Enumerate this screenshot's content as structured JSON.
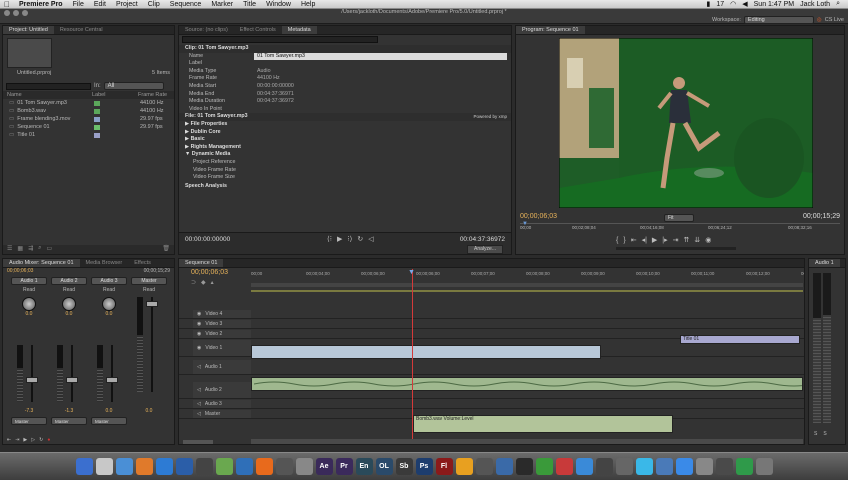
{
  "menubar": {
    "app_name": "Premiere Pro",
    "items": [
      "File",
      "Edit",
      "Project",
      "Clip",
      "Sequence",
      "Marker",
      "Title",
      "Window",
      "Help"
    ],
    "date_time": "Sun 1:47 PM",
    "user": "Jack Loth",
    "battery_level": "17"
  },
  "titlebar": {
    "path": "/Users/jackloth/Documents/Adobe/Premiere Pro/5.0/Untitled.prproj *",
    "workspace_label": "Workspace:",
    "workspace_value": "Editing",
    "cs_live": "CS Live"
  },
  "project_panel": {
    "tabs": [
      "Project: Untitled",
      "Resource Central"
    ],
    "project_file": "Untitled.prproj",
    "items_count": "5 Items",
    "in_label": "In:",
    "in_value": "All",
    "columns": [
      "Name",
      "Label",
      "Frame Rate"
    ],
    "rows": [
      {
        "name": "01 Tom Sawyer.mp3",
        "rate": "44100 Hz",
        "color": "#5ba85b"
      },
      {
        "name": "Bomb3.wav",
        "rate": "44100 Hz",
        "color": "#5ba85b"
      },
      {
        "name": "Frame blending3.mov",
        "rate": "29.97 fps",
        "color": "#8aa0c8"
      },
      {
        "name": "Sequence 01",
        "rate": "29.97 fps",
        "color": "#6bbf6b"
      },
      {
        "name": "Title 01",
        "rate": "",
        "color": "#9aa0c8"
      }
    ]
  },
  "metadata_panel": {
    "tabs": [
      "Source: (no clips)",
      "Effect Controls",
      "Metadata"
    ],
    "clip_header": "Clip: 01 Tom Sawyer.mp3",
    "fields": [
      {
        "k": "Name",
        "v": "01 Tom Sawyer.mp3",
        "input": true
      },
      {
        "k": "Label",
        "v": "",
        "input": false
      },
      {
        "k": "Media Type",
        "v": "Audio",
        "input": false
      },
      {
        "k": "Frame Rate",
        "v": "44100 Hz",
        "input": false
      },
      {
        "k": "Media Start",
        "v": "00:00:00:00000",
        "input": false
      },
      {
        "k": "Media End",
        "v": "00:04:37:36971",
        "input": false
      },
      {
        "k": "Media Duration",
        "v": "00:04:37:36972",
        "input": false
      },
      {
        "k": "Video In Point",
        "v": "",
        "input": false
      }
    ],
    "file_header": "File: 01 Tom Sawyer.mp3",
    "powered_by": "Powered by xmp",
    "sections": [
      "File Properties",
      "Dublin Core",
      "Basic",
      "Rights Management",
      "Dynamic Media"
    ],
    "dynamic_media": [
      "Project Reference",
      "Video Frame Rate",
      "Video Frame Size"
    ],
    "speech": "Speech Analysis",
    "timecode_in": "00:00:00:00000",
    "timecode_out": "00:04:37:36972",
    "analyze": "Analyze..."
  },
  "program_monitor": {
    "tab": "Program: Sequence 01",
    "timecode": "00;00;06;03",
    "fit": "Fit",
    "duration": "00;00;15;29",
    "ruler": [
      "00;00",
      "00;02;08;04",
      "00;04;16;08",
      "00;06;24;12",
      "00;08;32;16"
    ]
  },
  "audio_mixer": {
    "tabs": [
      "Audio Mixer: Sequence 01",
      "Media Browser",
      "Effects"
    ],
    "timecode_left": "00;00;06;03",
    "timecode_right": "00;00;15;29",
    "channels": [
      {
        "name": "Audio 1",
        "mode": "Read",
        "pan": "0.0",
        "level": "-7.3",
        "out": "Master"
      },
      {
        "name": "Audio 2",
        "mode": "Read",
        "pan": "0.0",
        "level": "-1.3",
        "out": "Master"
      },
      {
        "name": "Audio 3",
        "mode": "Read",
        "pan": "0.0",
        "level": "0.0",
        "out": "Master"
      },
      {
        "name": "Master",
        "mode": "Read",
        "pan": "",
        "level": "0.0",
        "out": ""
      }
    ]
  },
  "timeline": {
    "tab": "Sequence 01",
    "timecode": "00;00;06;03",
    "ruler": [
      "00;00",
      "00;00;04;00",
      "00;00;06;00",
      "00;00;06;00",
      "00;00;07;00",
      "00;00;08;00",
      "00;00;09;00",
      "00;00;10;00",
      "00;00;11;00",
      "00;00;12;00",
      "00;00;13"
    ],
    "tracks": [
      "Video 4",
      "Video 3",
      "Video 2",
      "Video 1",
      "Audio 1",
      "Audio 2",
      "Audio 3",
      "Master"
    ],
    "clip_title": "Title 01",
    "clip_audio2": "Bomb3.wav  Volume:Level"
  },
  "audio_meter": {
    "tab": "Audio 1"
  },
  "dock": [
    {
      "label": "",
      "color": "#3b6fcf"
    },
    {
      "label": "",
      "color": "#c8c8c8"
    },
    {
      "label": "",
      "color": "#4a8fd6"
    },
    {
      "label": "",
      "color": "#e07a2b"
    },
    {
      "label": "",
      "color": "#2d7bd4"
    },
    {
      "label": "",
      "color": "#2b5ea8"
    },
    {
      "label": "",
      "color": "#444"
    },
    {
      "label": "",
      "color": "#6aa84f"
    },
    {
      "label": "",
      "color": "#2f6fb8"
    },
    {
      "label": "",
      "color": "#e86a1c"
    },
    {
      "label": "",
      "color": "#555"
    },
    {
      "label": "",
      "color": "#888"
    },
    {
      "label": "Ae",
      "color": "#3a2a5a"
    },
    {
      "label": "Pr",
      "color": "#3b2a5c"
    },
    {
      "label": "En",
      "color": "#2a4a5a"
    },
    {
      "label": "OL",
      "color": "#2a4a6a"
    },
    {
      "label": "Sb",
      "color": "#3a3a3a"
    },
    {
      "label": "Ps",
      "color": "#1d3d6e"
    },
    {
      "label": "Fl",
      "color": "#8a1a1a"
    },
    {
      "label": "",
      "color": "#e8a020"
    },
    {
      "label": "",
      "color": "#555"
    },
    {
      "label": "",
      "color": "#3a6aa8"
    },
    {
      "label": "",
      "color": "#2a2a2a"
    },
    {
      "label": "",
      "color": "#3a9a3a"
    },
    {
      "label": "",
      "color": "#c83a3a"
    },
    {
      "label": "",
      "color": "#3a8ad8"
    },
    {
      "label": "",
      "color": "#444"
    },
    {
      "label": "",
      "color": "#666"
    },
    {
      "label": "",
      "color": "#3ab8e8"
    },
    {
      "label": "",
      "color": "#4a7ab8"
    },
    {
      "label": "",
      "color": "#3a8ae8"
    },
    {
      "label": "",
      "color": "#888"
    },
    {
      "label": "",
      "color": "#4a4a4a"
    },
    {
      "label": "",
      "color": "#2f9a4a"
    },
    {
      "label": "",
      "color": "#777"
    }
  ]
}
